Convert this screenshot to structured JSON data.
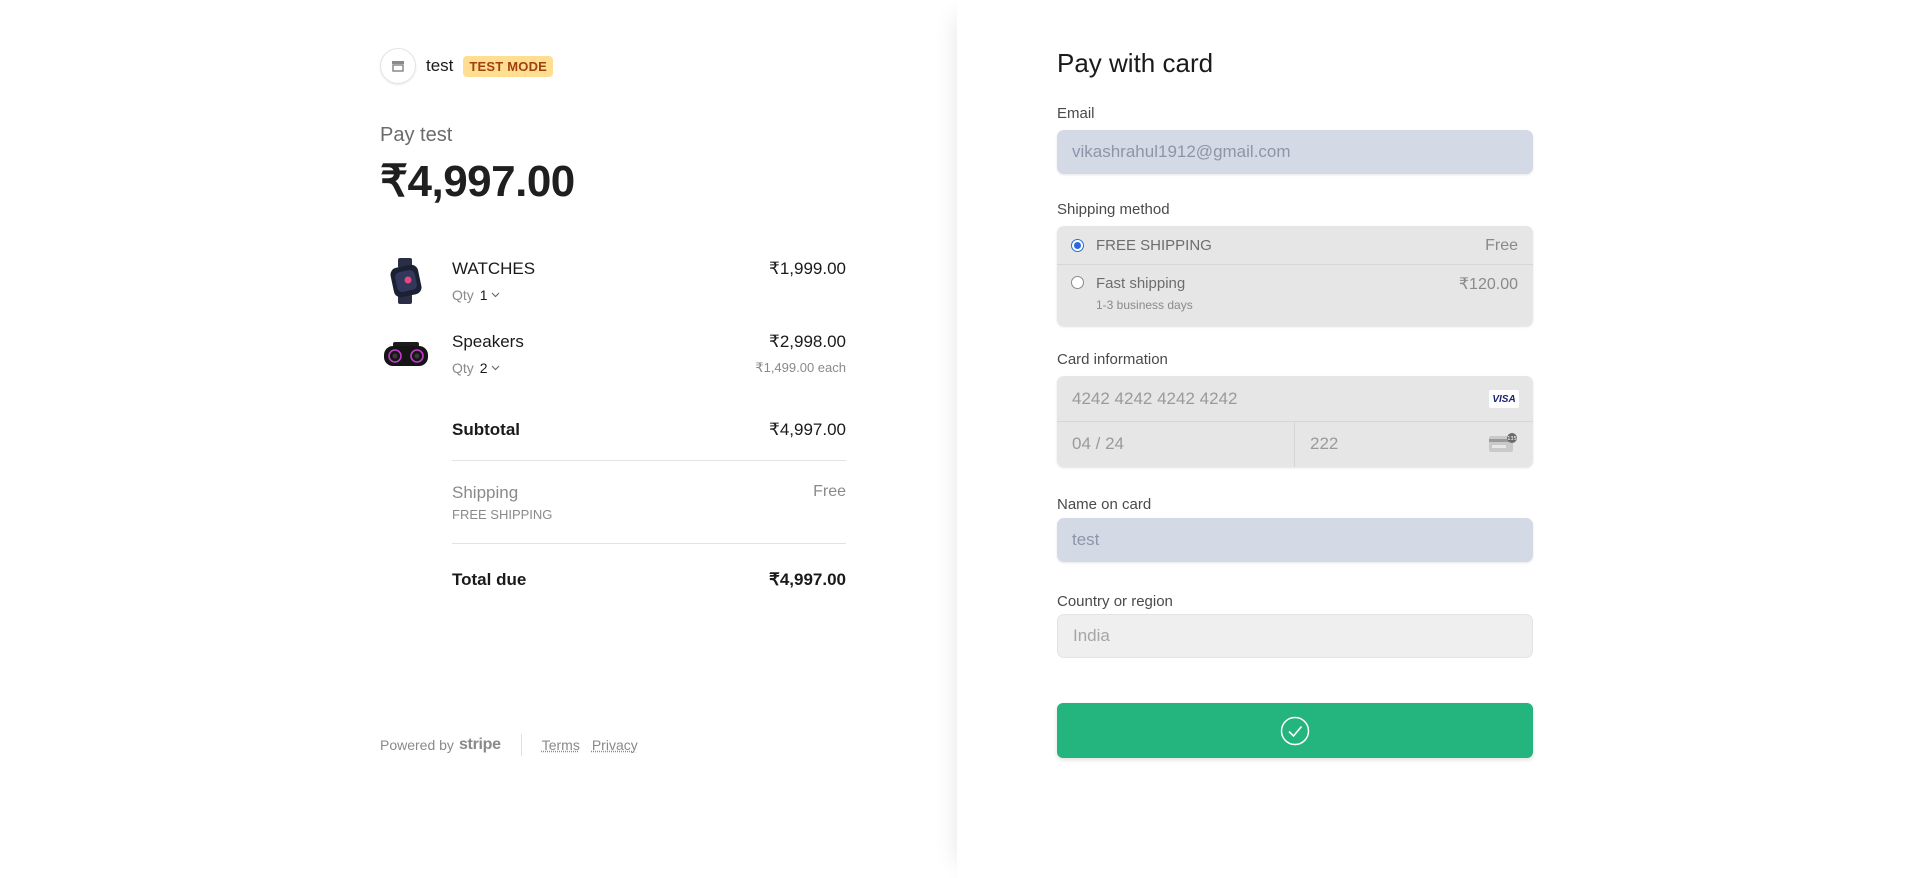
{
  "merchant": {
    "name": "test",
    "badge": "TEST MODE"
  },
  "summary": {
    "pay_label": "Pay test",
    "amount": "₹4,997.00",
    "items": [
      {
        "name": "WATCHES",
        "qty_label": "Qty",
        "qty": "1",
        "price": "₹1,999.00",
        "each": ""
      },
      {
        "name": "Speakers",
        "qty_label": "Qty",
        "qty": "2",
        "price": "₹2,998.00",
        "each": "₹1,499.00 each"
      }
    ],
    "subtotal_label": "Subtotal",
    "subtotal": "₹4,997.00",
    "shipping_label": "Shipping",
    "shipping_method": "FREE SHIPPING",
    "shipping_value": "Free",
    "total_label": "Total due",
    "total": "₹4,997.00"
  },
  "footer": {
    "powered_by": "Powered by",
    "brand": "stripe",
    "terms": "Terms",
    "privacy": "Privacy"
  },
  "form": {
    "title": "Pay with card",
    "email_label": "Email",
    "email_value": "vikashrahul1912@gmail.com",
    "shipping_label": "Shipping method",
    "shipping_options": [
      {
        "name": "FREE SHIPPING",
        "price": "Free",
        "sub": "",
        "selected": true
      },
      {
        "name": "Fast shipping",
        "price": "₹120.00",
        "sub": "1-3 business days",
        "selected": false
      }
    ],
    "card_label": "Card information",
    "card_number": "4242 4242 4242 4242",
    "card_brand": "VISA",
    "card_expiry": "04 / 24",
    "card_cvc": "222",
    "name_label": "Name on card",
    "name_value": "test",
    "country_label": "Country or region",
    "country_value": "India"
  },
  "colors": {
    "pay_button": "#24b47e",
    "badge_bg": "#ffde92",
    "badge_text": "#a0420f",
    "radio_selected": "#2b6bd8"
  }
}
